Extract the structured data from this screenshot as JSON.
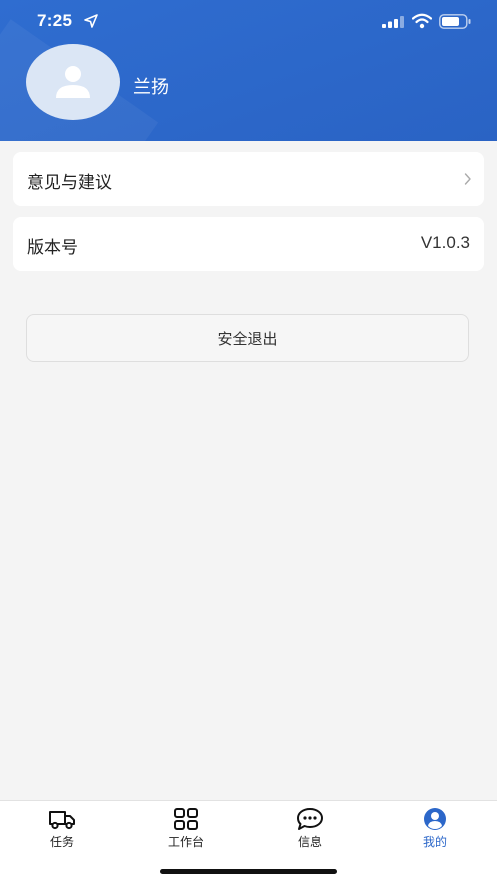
{
  "status": {
    "time": "7:25"
  },
  "profile": {
    "name": "兰扬"
  },
  "menu": {
    "feedback_label": "意见与建议",
    "version_label": "版本号",
    "version_value": "V1.0.3"
  },
  "logout_label": "安全退出",
  "tabs": [
    {
      "label": "任务",
      "icon": "truck-icon"
    },
    {
      "label": "工作台",
      "icon": "grid-icon"
    },
    {
      "label": "信息",
      "icon": "chat-icon"
    },
    {
      "label": "我的",
      "icon": "user-circle-icon"
    }
  ],
  "colors": {
    "primary": "#2c67c9",
    "background": "#f4f4f4"
  }
}
